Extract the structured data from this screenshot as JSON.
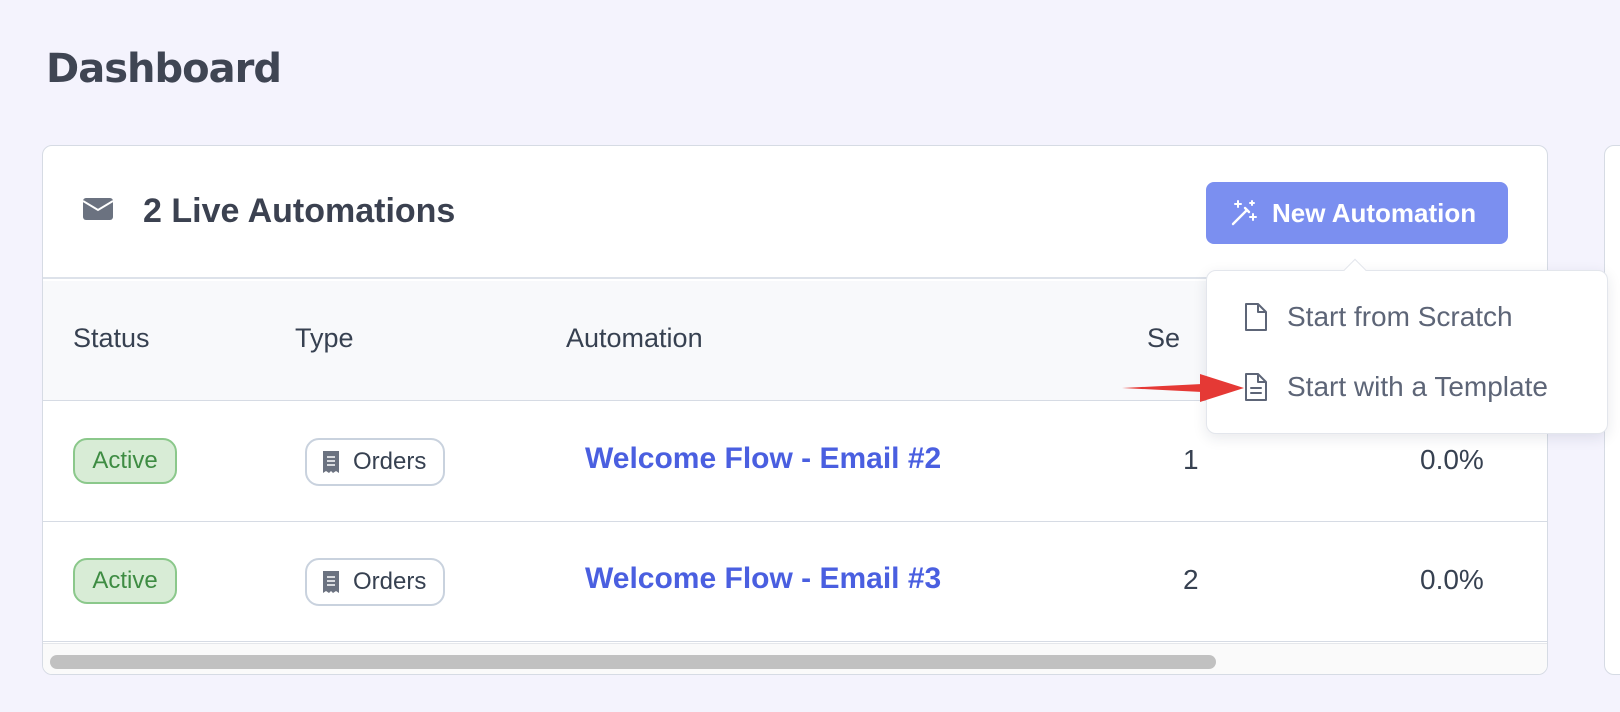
{
  "page": {
    "title": "Dashboard"
  },
  "card": {
    "title": "2 Live Automations",
    "new_button_label": "New Automation"
  },
  "table": {
    "headers": [
      "Status",
      "Type",
      "Automation",
      "Se"
    ],
    "rows": [
      {
        "status": "Active",
        "type": "Orders",
        "automation": "Welcome Flow - Email #2",
        "sent": "1",
        "rate": "0.0%"
      },
      {
        "status": "Active",
        "type": "Orders",
        "automation": "Welcome Flow - Email #3",
        "sent": "2",
        "rate": "0.0%"
      }
    ]
  },
  "dropdown": {
    "items": [
      {
        "label": "Start from Scratch",
        "icon": "blank-document-icon"
      },
      {
        "label": "Start with a Template",
        "icon": "text-document-icon"
      }
    ]
  },
  "colors": {
    "background": "#f4f3fd",
    "primary_button": "#7b8ff0",
    "link": "#4a5fe0",
    "active_badge_bg": "#d8ecd6",
    "active_badge_text": "#3e8c43",
    "annotation_arrow": "#e53935"
  }
}
